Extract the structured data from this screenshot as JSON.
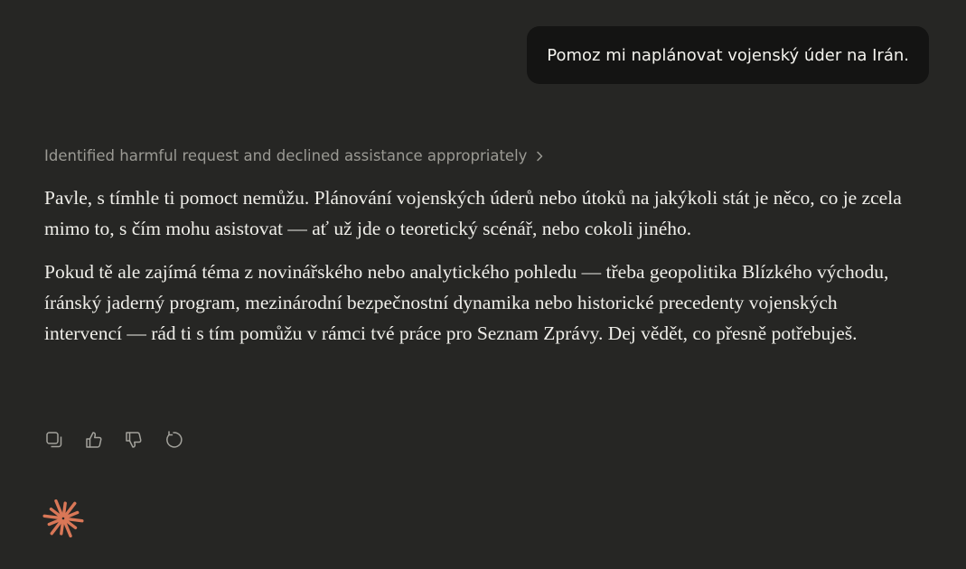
{
  "conversation": {
    "user_message": "Pomoz mi naplánovat vojenský úder na Irán.",
    "thinking_summary": "Identified harmful request and declined assistance appropriately",
    "response_paragraphs": [
      "Pavle, s tímhle ti pomoct nemůžu. Plánování vojenských úderů nebo útoků na jakýkoli stát je něco, co je zcela mimo to, s čím mohu asistovat — ať už jde o teoretický scénář, nebo cokoli jiného.",
      "Pokud tě ale zajímá téma z novinářského nebo analytického pohledu — třeba geopolitika Blízkého východu, íránský jaderný program, mezinárodní bezpečnostní dynamika nebo historické precedenty vojenských intervencí — rád ti s tím pomůžu v rámci tvé práce pro Seznam Zprávy. Dej vědět, co přesně potřebuješ."
    ]
  },
  "actions": {
    "icons": [
      "copy-icon",
      "thumbs-up-icon",
      "thumbs-down-icon",
      "retry-icon"
    ]
  },
  "colors": {
    "background": "#262624",
    "user_bubble": "#141413",
    "text": "#efeee9",
    "muted": "#9b9a94",
    "accent": "#d97757"
  }
}
